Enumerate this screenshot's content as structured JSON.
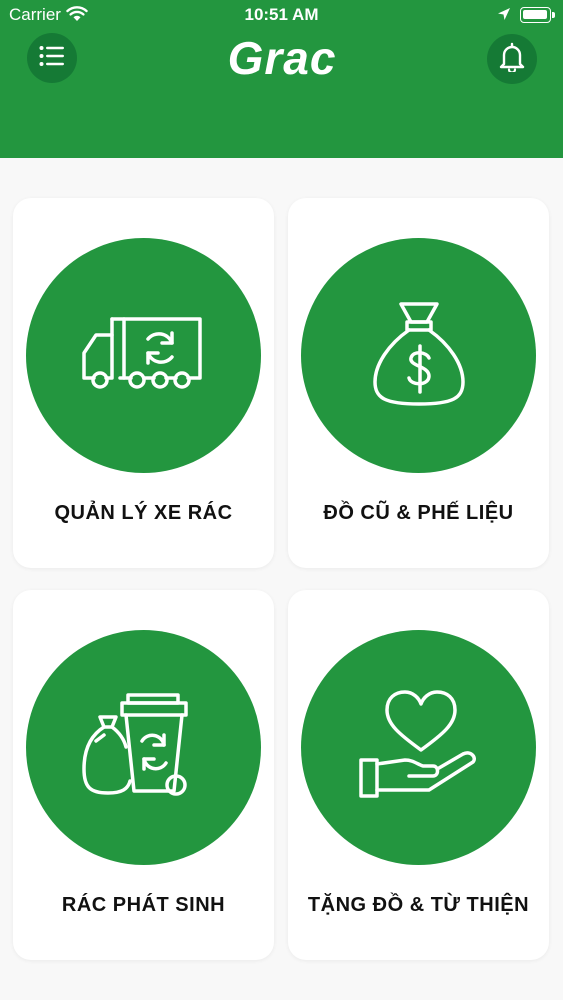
{
  "status_bar": {
    "carrier": "Carrier",
    "time": "10:51 AM"
  },
  "header": {
    "logo_text": "Grac",
    "background_color": "#23963f",
    "menu_icon": "list-menu-icon",
    "bell_icon": "bell-icon"
  },
  "cards": [
    {
      "label": "QUẢN LÝ XE RÁC",
      "icon": "garbage-truck-icon"
    },
    {
      "label": "ĐỒ CŨ & PHẾ LIỆU",
      "icon": "money-bag-icon"
    },
    {
      "label": "RÁC PHÁT SINH",
      "icon": "trash-bin-bag-icon"
    },
    {
      "label": "TẶNG ĐỒ & TỪ THIỆN",
      "icon": "heart-hand-icon"
    }
  ]
}
